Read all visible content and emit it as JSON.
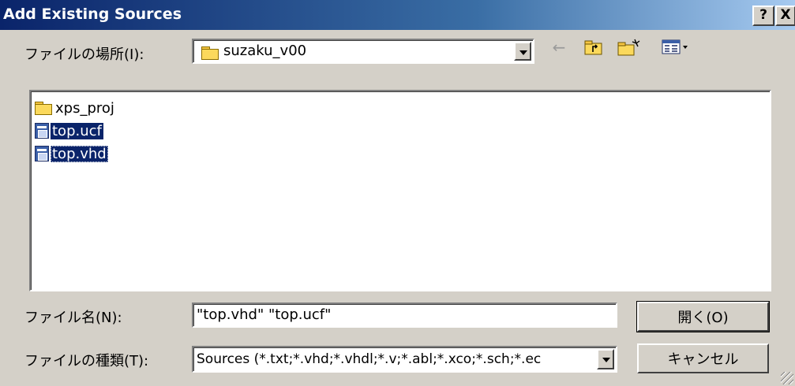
{
  "window": {
    "title": "Add Existing Sources",
    "help_label": "?",
    "close_label": "X"
  },
  "look_in": {
    "label": "ファイルの場所(I):",
    "folder_icon": "folder-icon",
    "value": "suzaku_v00"
  },
  "toolbar": {
    "back_icon": "←",
    "up_icon": "up-folder-icon",
    "new_folder_icon": "new-folder-icon",
    "view_icon": "view-menu-icon"
  },
  "files": [
    {
      "name": "xps_proj",
      "type": "folder",
      "icon": "folder-icon",
      "selected": false
    },
    {
      "name": "top.ucf",
      "type": "file",
      "icon": "file-icon",
      "selected": true
    },
    {
      "name": "top.vhd",
      "type": "file",
      "icon": "file-icon",
      "selected": true
    }
  ],
  "filename": {
    "label": "ファイル名(N):",
    "value": "\"top.vhd\" \"top.ucf\""
  },
  "filetype": {
    "label": "ファイルの種類(T):",
    "value": "Sources (*.txt;*.vhd;*.vhdl;*.v;*.abl;*.xco;*.sch;*.ec"
  },
  "buttons": {
    "open_label": "開く(O)",
    "cancel_label": "キャンセル"
  },
  "colors": {
    "titlebar_start": "#0a246a",
    "titlebar_end": "#a6caf0",
    "selection": "#0a246a",
    "face": "#d4d0c8"
  }
}
